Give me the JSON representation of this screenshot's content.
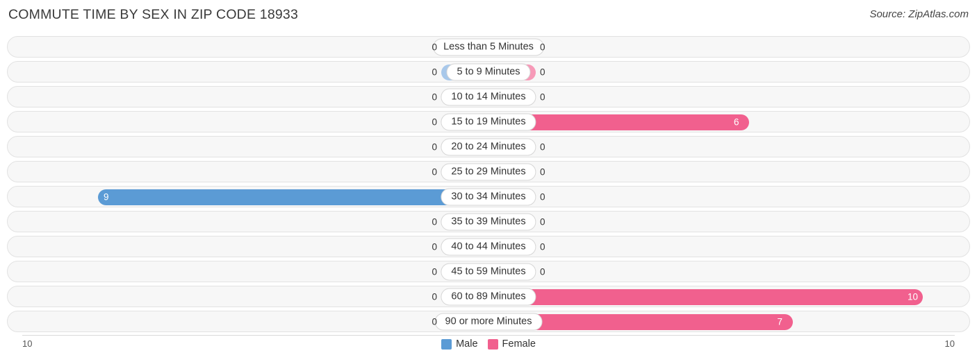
{
  "header": {
    "title": "COMMUTE TIME BY SEX IN ZIP CODE 18933",
    "source": "Source: ZipAtlas.com"
  },
  "legend": {
    "male_label": "Male",
    "female_label": "Female",
    "male_color": "#5b9bd5",
    "female_color": "#f1608e"
  },
  "axis": {
    "left_label": "10",
    "right_label": "10"
  },
  "chart_data": {
    "type": "bar",
    "subtype": "diverging-bidirectional",
    "title": "COMMUTE TIME BY SEX IN ZIP CODE 18933",
    "xlabel": "",
    "ylabel": "",
    "xlim": [
      10,
      0,
      10
    ],
    "categories": [
      "Less than 5 Minutes",
      "5 to 9 Minutes",
      "10 to 14 Minutes",
      "15 to 19 Minutes",
      "20 to 24 Minutes",
      "25 to 29 Minutes",
      "30 to 34 Minutes",
      "35 to 39 Minutes",
      "40 to 44 Minutes",
      "45 to 59 Minutes",
      "60 to 89 Minutes",
      "90 or more Minutes"
    ],
    "series": [
      {
        "name": "Male",
        "color": "#5b9bd5",
        "values": [
          0,
          0,
          0,
          0,
          0,
          0,
          9,
          0,
          0,
          0,
          0,
          0
        ]
      },
      {
        "name": "Female",
        "color": "#f1608e",
        "values": [
          0,
          0,
          0,
          6,
          0,
          0,
          0,
          0,
          0,
          0,
          10,
          7
        ]
      }
    ],
    "value_labels": {
      "male": [
        "0",
        "0",
        "0",
        "0",
        "0",
        "0",
        "9",
        "0",
        "0",
        "0",
        "0",
        "0"
      ],
      "female": [
        "0",
        "0",
        "0",
        "6",
        "0",
        "0",
        "0",
        "0",
        "0",
        "0",
        "10",
        "7"
      ]
    },
    "grid": false,
    "legend_position": "bottom-center"
  }
}
